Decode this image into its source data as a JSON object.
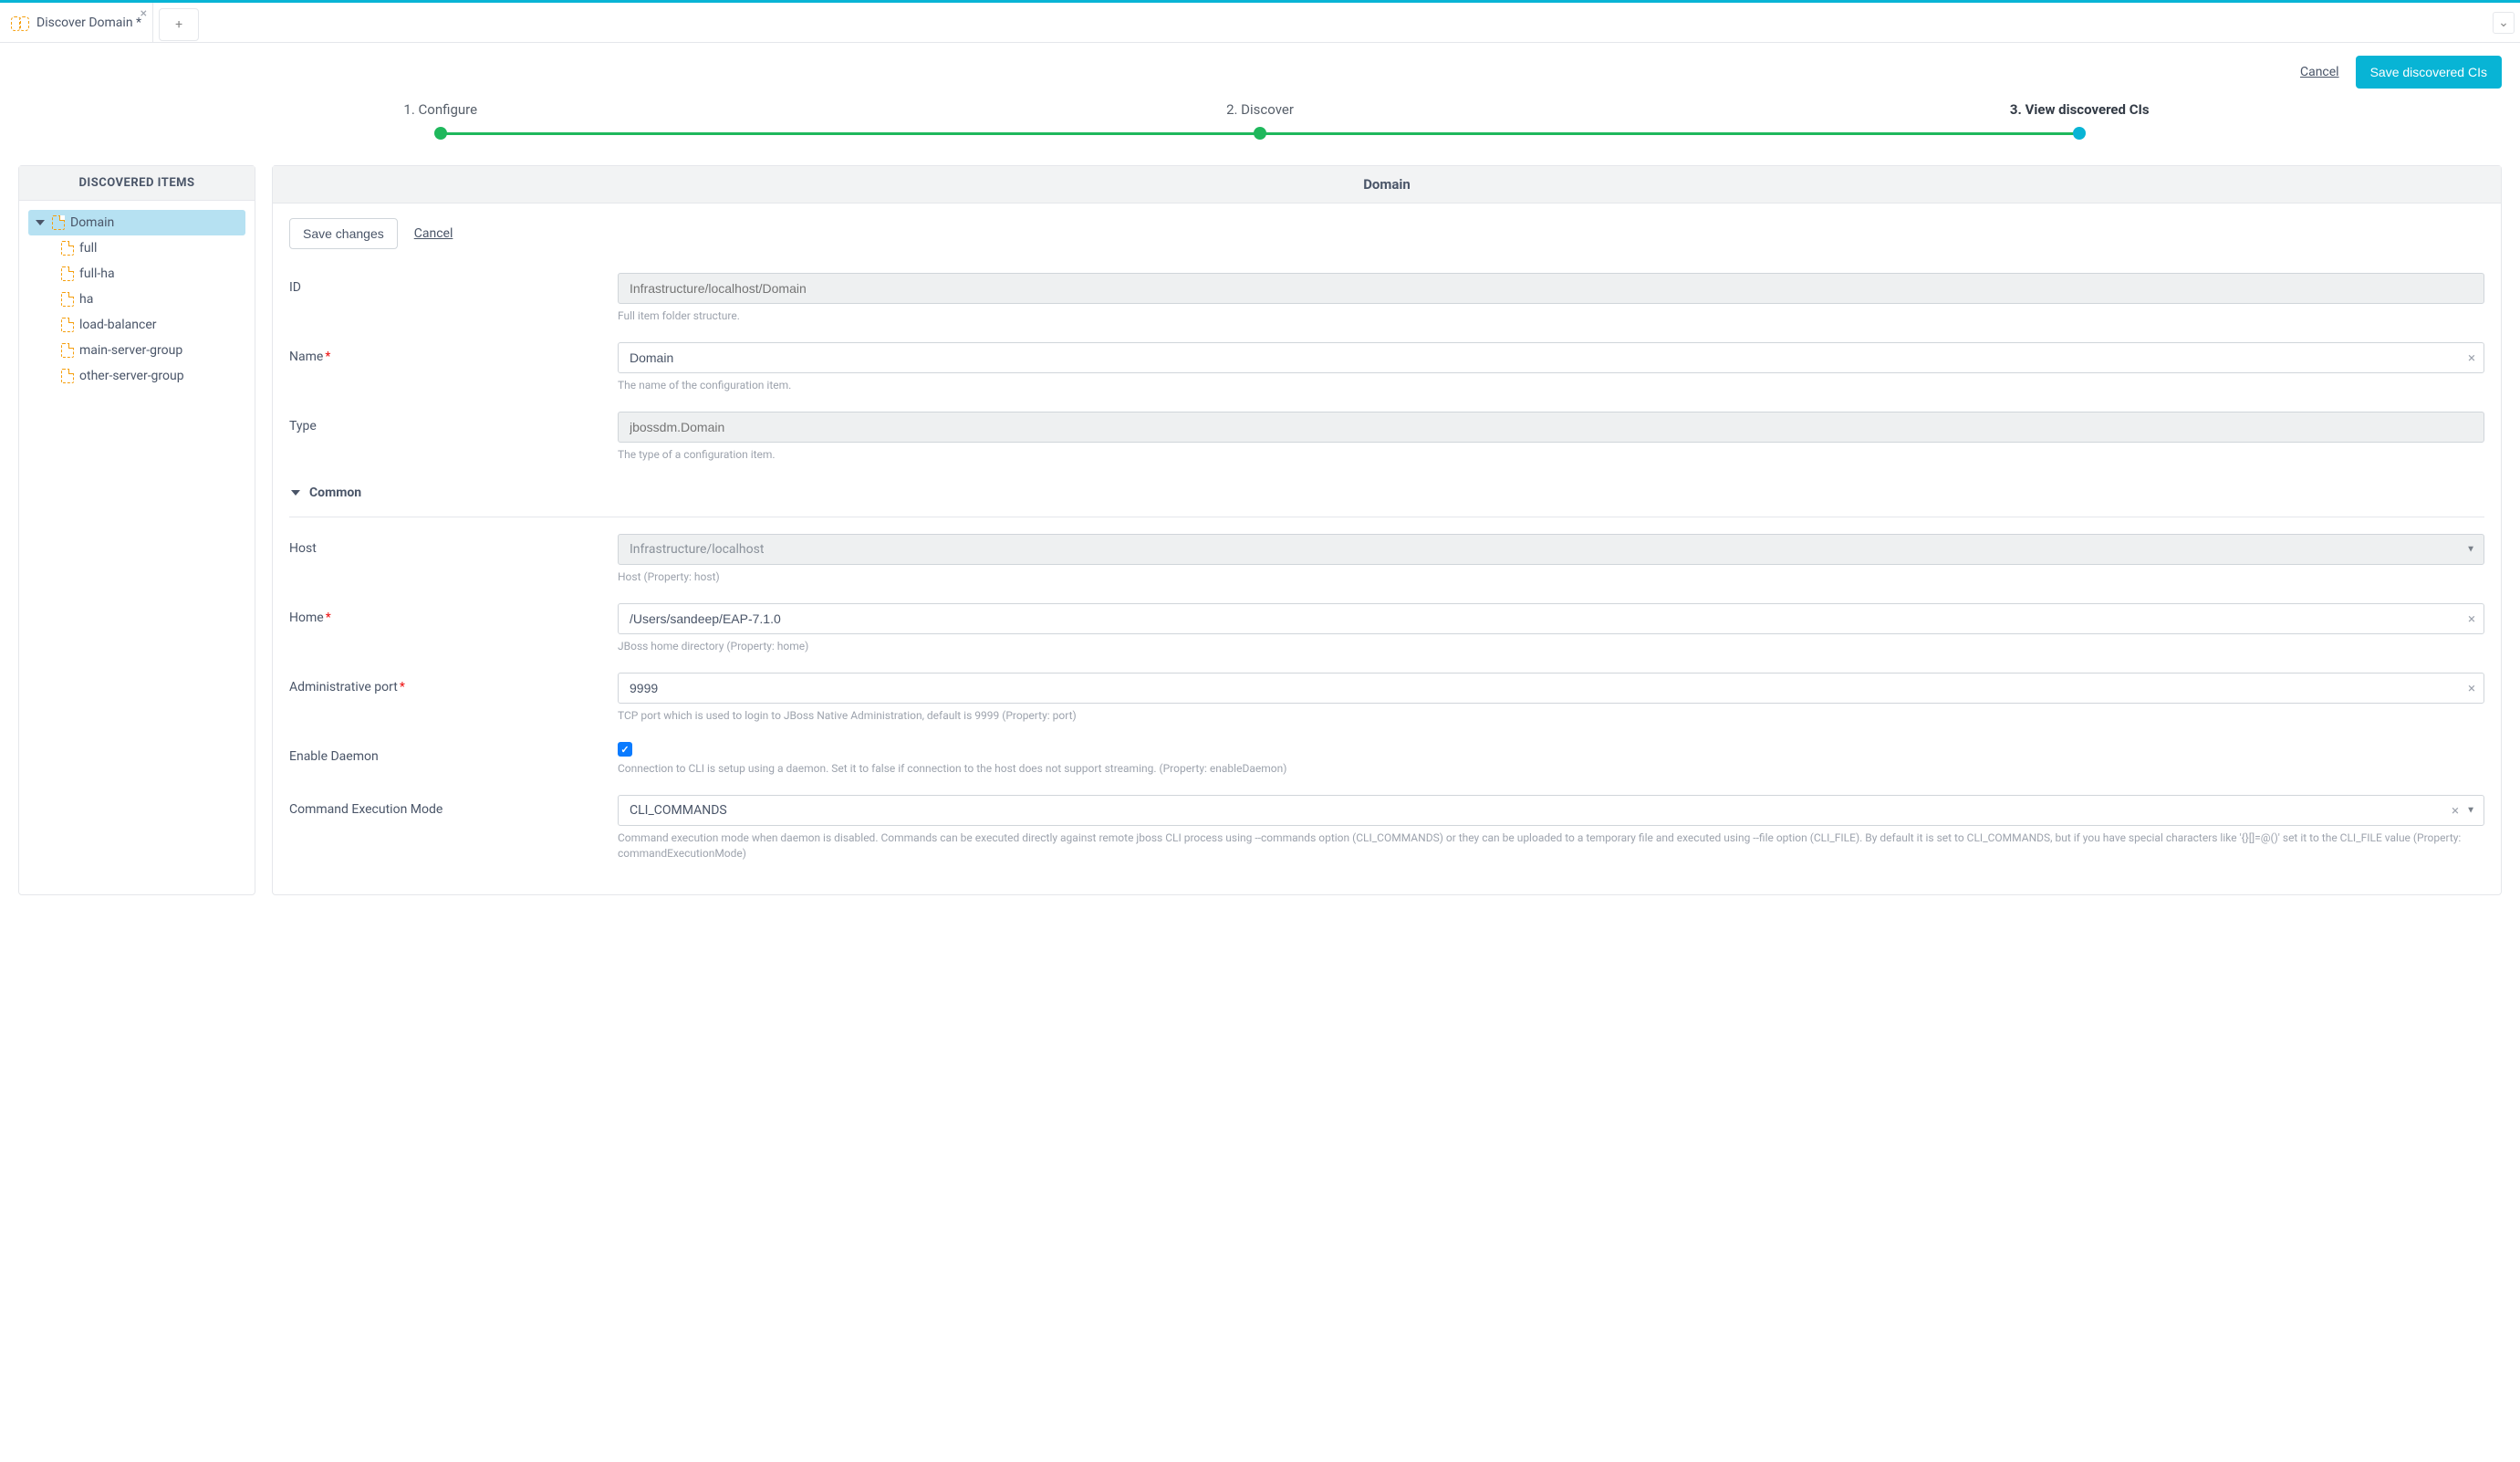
{
  "tab": {
    "title": "Discover Domain *"
  },
  "actions": {
    "cancel": "Cancel",
    "save": "Save discovered CIs"
  },
  "steps": [
    "1. Configure",
    "2. Discover",
    "3. View discovered CIs"
  ],
  "sidebar": {
    "title": "DISCOVERED ITEMS",
    "root": "Domain",
    "children": [
      "full",
      "full-ha",
      "ha",
      "load-balancer",
      "main-server-group",
      "other-server-group"
    ]
  },
  "main": {
    "title": "Domain",
    "form_actions": {
      "save": "Save changes",
      "cancel": "Cancel"
    },
    "fields": {
      "id": {
        "label": "ID",
        "placeholder": "Infrastructure/localhost/Domain",
        "help": "Full item folder structure."
      },
      "name": {
        "label": "Name",
        "value": "Domain",
        "help": "The name of the configuration item."
      },
      "type": {
        "label": "Type",
        "placeholder": "jbossdm.Domain",
        "help": "The type of a configuration item."
      }
    },
    "section_common": "Common",
    "common_fields": {
      "host": {
        "label": "Host",
        "value": "Infrastructure/localhost",
        "help": "Host (Property: host)"
      },
      "home": {
        "label": "Home",
        "value": "/Users/sandeep/EAP-7.1.0",
        "help": "JBoss home directory (Property: home)"
      },
      "admin_port": {
        "label": "Administrative port",
        "value": "9999",
        "help": "TCP port which is used to login to JBoss Native Administration, default is 9999 (Property: port)"
      },
      "enable_daemon": {
        "label": "Enable Daemon",
        "help": "Connection to CLI is setup using a daemon. Set it to false if connection to the host does not support streaming. (Property: enableDaemon)"
      },
      "cmd_mode": {
        "label": "Command Execution Mode",
        "value": "CLI_COMMANDS",
        "help": "Command execution mode when daemon is disabled. Commands can be executed directly against remote jboss CLI process using --commands option (CLI_COMMANDS) or they can be uploaded to a temporary file and executed using --file option (CLI_FILE). By default it is set to CLI_COMMANDS, but if you have special characters like '{}[]=@()' set it to the CLI_FILE value (Property: commandExecutionMode)"
      }
    }
  }
}
